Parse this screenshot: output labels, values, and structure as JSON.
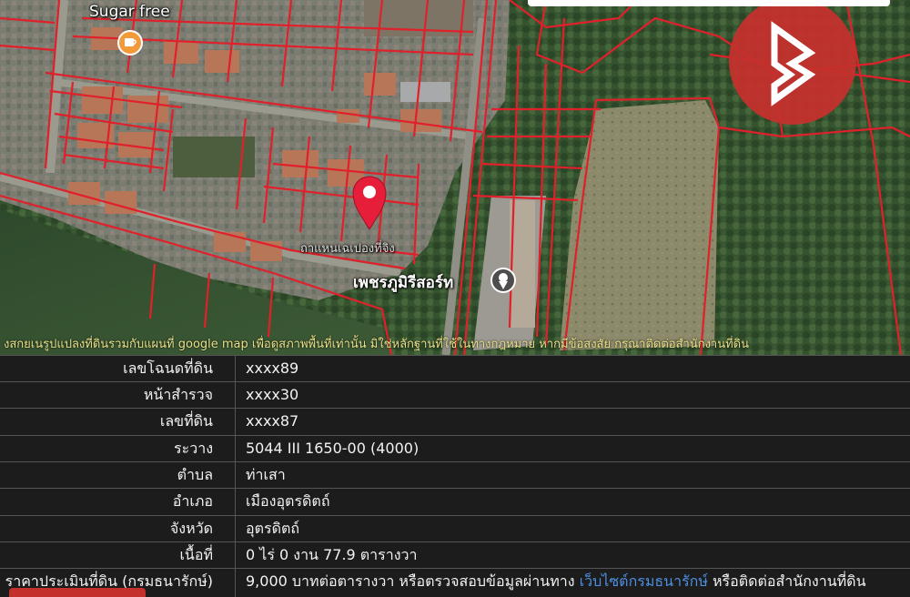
{
  "map": {
    "poi_sugar": "Sugar free",
    "poi_village": "ถาแหนเฉเปองที่จิง",
    "poi_resort": "เพชรภูมิรีสอร์ท",
    "logo_icon": "brand-b-logo",
    "pin_icon": "location-pin-icon",
    "cafe_icon": "cafe-icon",
    "place_icon": "place-marker-icon",
    "marquee": "งสกยเนรูปแปลงที่ดินรวมกับแผนที่ google map เพื่อดูสภาพพื้นที่เท่านั้น มิใช่หลักฐานที่ใช้ในทางกฎหมาย หากมีข้อสงสัย กรุณาติดต่อสำนักงานที่ดิน",
    "colors": {
      "parcel_lines": "#e0202a",
      "logo_bg": "#c4302c",
      "marquee_text": "#e8e08a"
    }
  },
  "info_table": {
    "rows": [
      {
        "key": "เลขโฉนดที่ดิน",
        "value": "xxxx89"
      },
      {
        "key": "หน้าสำรวจ",
        "value": "xxxx30"
      },
      {
        "key": "เลขที่ดิน",
        "value": "xxxx87"
      },
      {
        "key": "ระวาง",
        "value": "5044 III 1650-00 (4000)"
      },
      {
        "key": "ตำบล",
        "value": "ท่าเสา"
      },
      {
        "key": "อำเภอ",
        "value": "เมืองอุตรดิตถ์"
      },
      {
        "key": "จังหวัด",
        "value": "อุตรดิตถ์"
      },
      {
        "key": "เนื้อที่",
        "value": "0 ไร่ 0 งาน 77.9 ตารางวา"
      }
    ],
    "price_row": {
      "key": "ราคาประเมินที่ดิน (กรมธนารักษ์)",
      "value_prefix": "9,000 บาทต่อตารางวา หรือตรวจสอบข้อมูลผ่านทาง ",
      "value_link": "เว็บไซต์กรมธนารักษ์",
      "value_suffix": " หรือติดต่อสำนักงานที่ดิน"
    }
  }
}
